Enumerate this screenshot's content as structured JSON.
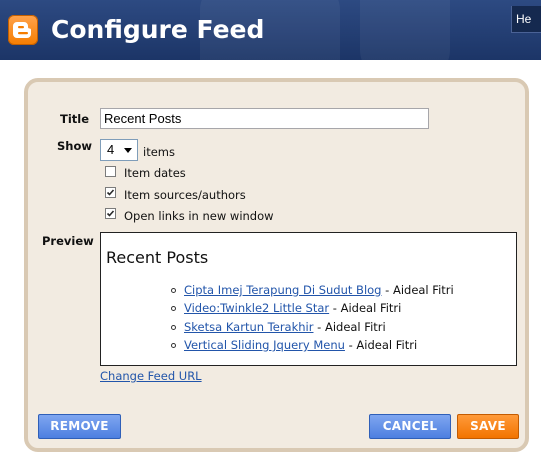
{
  "header": {
    "title": "Configure Feed",
    "help_label": "He",
    "brand_color": "#1c3567",
    "logo_icon": "blogger-logo-icon"
  },
  "form": {
    "title_label": "Title",
    "title_value": "Recent Posts",
    "show_label": "Show",
    "show_value": "4",
    "show_suffix": "items",
    "options": [
      {
        "label": "Item dates",
        "checked": false
      },
      {
        "label": "Item sources/authors",
        "checked": true
      },
      {
        "label": "Open links in new window",
        "checked": true
      }
    ]
  },
  "preview": {
    "label": "Preview",
    "heading": "Recent Posts",
    "posts": [
      {
        "title": "Cipta Imej Terapung Di Sudut Blog",
        "separator": " - ",
        "author": "Aideal Fitri"
      },
      {
        "title": "Video:Twinkle2 Little Star",
        "separator": " - ",
        "author": "Aideal Fitri"
      },
      {
        "title": "Sketsa Kartun Terakhir",
        "separator": " - ",
        "author": "Aideal Fitri"
      },
      {
        "title": "Vertical Sliding Jquery Menu",
        "separator": " - ",
        "author": "Aideal Fitri"
      }
    ],
    "link_color": "#2255aa"
  },
  "change_feed_label": "Change Feed URL",
  "buttons": {
    "remove": "REMOVE",
    "cancel": "CANCEL",
    "save": "SAVE",
    "blue_color": "#4d7fe0",
    "orange_color": "#f27400"
  }
}
